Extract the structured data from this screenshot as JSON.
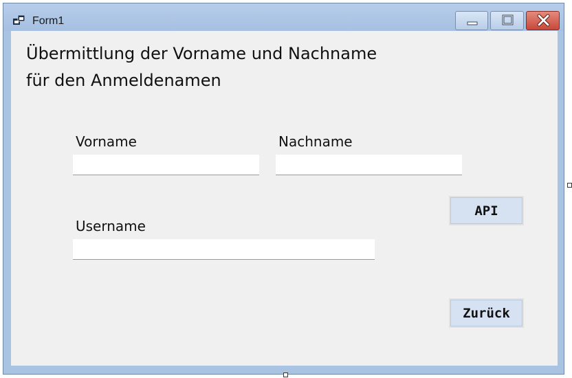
{
  "window": {
    "title": "Form1",
    "controls": {
      "minimize": "minimize-icon",
      "maximize": "maximize-icon",
      "close": "close-icon"
    }
  },
  "form": {
    "heading_line1": "Übermittlung der Vorname und Nachname",
    "heading_line2": "für den Anmeldenamen",
    "vorname_label": "Vorname",
    "nachname_label": "Nachname",
    "username_label": "Username",
    "vorname_value": "",
    "nachname_value": "",
    "username_value": "",
    "api_button": "API",
    "back_button": "Zurück"
  },
  "colors": {
    "close_button": "#c7493a",
    "button_face": "#d6e2f1",
    "client_bg": "#f0f0f0"
  }
}
